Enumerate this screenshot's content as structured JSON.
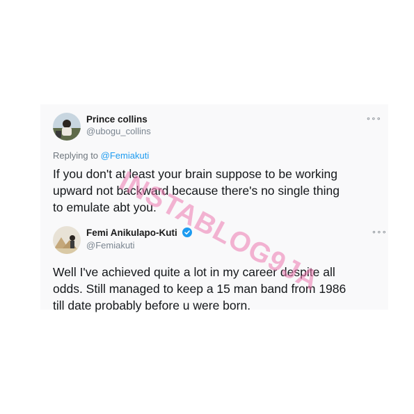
{
  "reply_tweet": {
    "author_name": "Prince collins",
    "handle": "@ubogu_collins",
    "more_icon": "more-dots-icon",
    "replying_prefix": "Replying to",
    "replying_to": "@Femiakuti",
    "lines": [
      "If you don't at least your brain suppose to be working",
      "upward not backward because there's no single thing",
      "to emulate abt you."
    ]
  },
  "response_tweet": {
    "author_name": "Femi Anikulapo-Kuti",
    "verified_icon": "verified-badge-icon",
    "handle": "@Femiakuti",
    "more_icon": "more-dots-icon",
    "lines": [
      "Well I've achieved quite a lot in my career despite all",
      "odds. Still managed to keep a 15 man band from 1986",
      "till date probably before u were born."
    ]
  },
  "watermark": "INSTABLOG9JA",
  "colors": {
    "link": "#1d9bf0",
    "verified": "#1d9bf0",
    "watermark": "#ec78af"
  }
}
